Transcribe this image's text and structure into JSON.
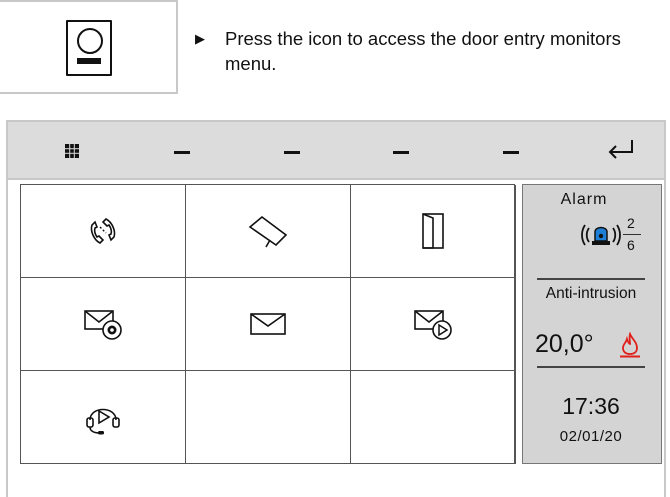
{
  "instruction": {
    "text": "Press the icon to access the door entry monitors menu."
  },
  "topbar": {
    "icons": [
      "grid-menu-icon",
      "dash-icon",
      "dash-icon",
      "dash-icon",
      "dash-icon",
      "back-arrow-icon"
    ]
  },
  "tiles": [
    {
      "icon": "call-transfer-icon"
    },
    {
      "icon": "camera-icon"
    },
    {
      "icon": "door-icon"
    },
    {
      "icon": "message-settings-icon"
    },
    {
      "icon": "envelope-icon"
    },
    {
      "icon": "message-play-icon"
    },
    {
      "icon": "answering-machine-icon"
    },
    {
      "icon": ""
    },
    {
      "icon": ""
    }
  ],
  "side_panel": {
    "alarm_title": "Alarm",
    "alarm_numerator": "2",
    "alarm_denominator": "6",
    "anti_intrusion": "Anti-intrusion",
    "temperature": "20,0°",
    "time": "17:36",
    "date": "02/01/20"
  },
  "colors": {
    "topbar": "#dcdcdc",
    "side_panel": "#d4d4d4",
    "alarm_blue": "#1e7fd6",
    "flame_red": "#e0201a"
  }
}
